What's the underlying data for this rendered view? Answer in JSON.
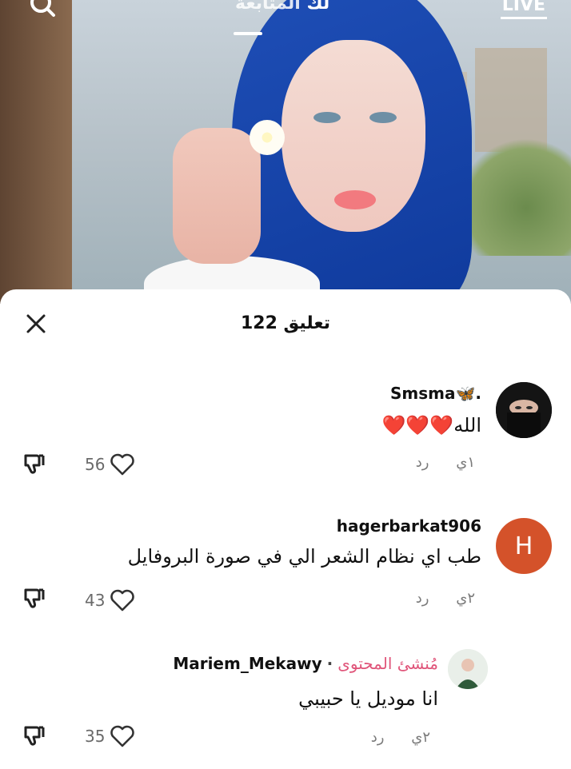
{
  "top_bar": {
    "following_tab": "المتابعة",
    "foryou_tab": "لك",
    "live_label": "LIVE"
  },
  "sheet": {
    "title": "122 تعليق"
  },
  "comments": [
    {
      "username": "Smsma🦋.",
      "text": "الله❤️❤️❤️",
      "time": "١ي",
      "reply": "رد",
      "likes": "56"
    },
    {
      "username": "hagerbarkat906",
      "avatar_letter": "H",
      "text": "طب اي نظام الشعر الي في صورة البروفايل",
      "time": "٢ي",
      "reply": "رد",
      "likes": "43"
    },
    {
      "username": "Mariem_Mekawy",
      "creator_label": "مُنشئ المحتوى",
      "text": "انا موديل يا حبيبي",
      "time": "٢ي",
      "reply": "رد",
      "likes": "35"
    }
  ],
  "colors": {
    "avatar_orange": "#d4522a",
    "creator_pink": "#e0557a",
    "hijab_blue": "#1f4fb7"
  }
}
